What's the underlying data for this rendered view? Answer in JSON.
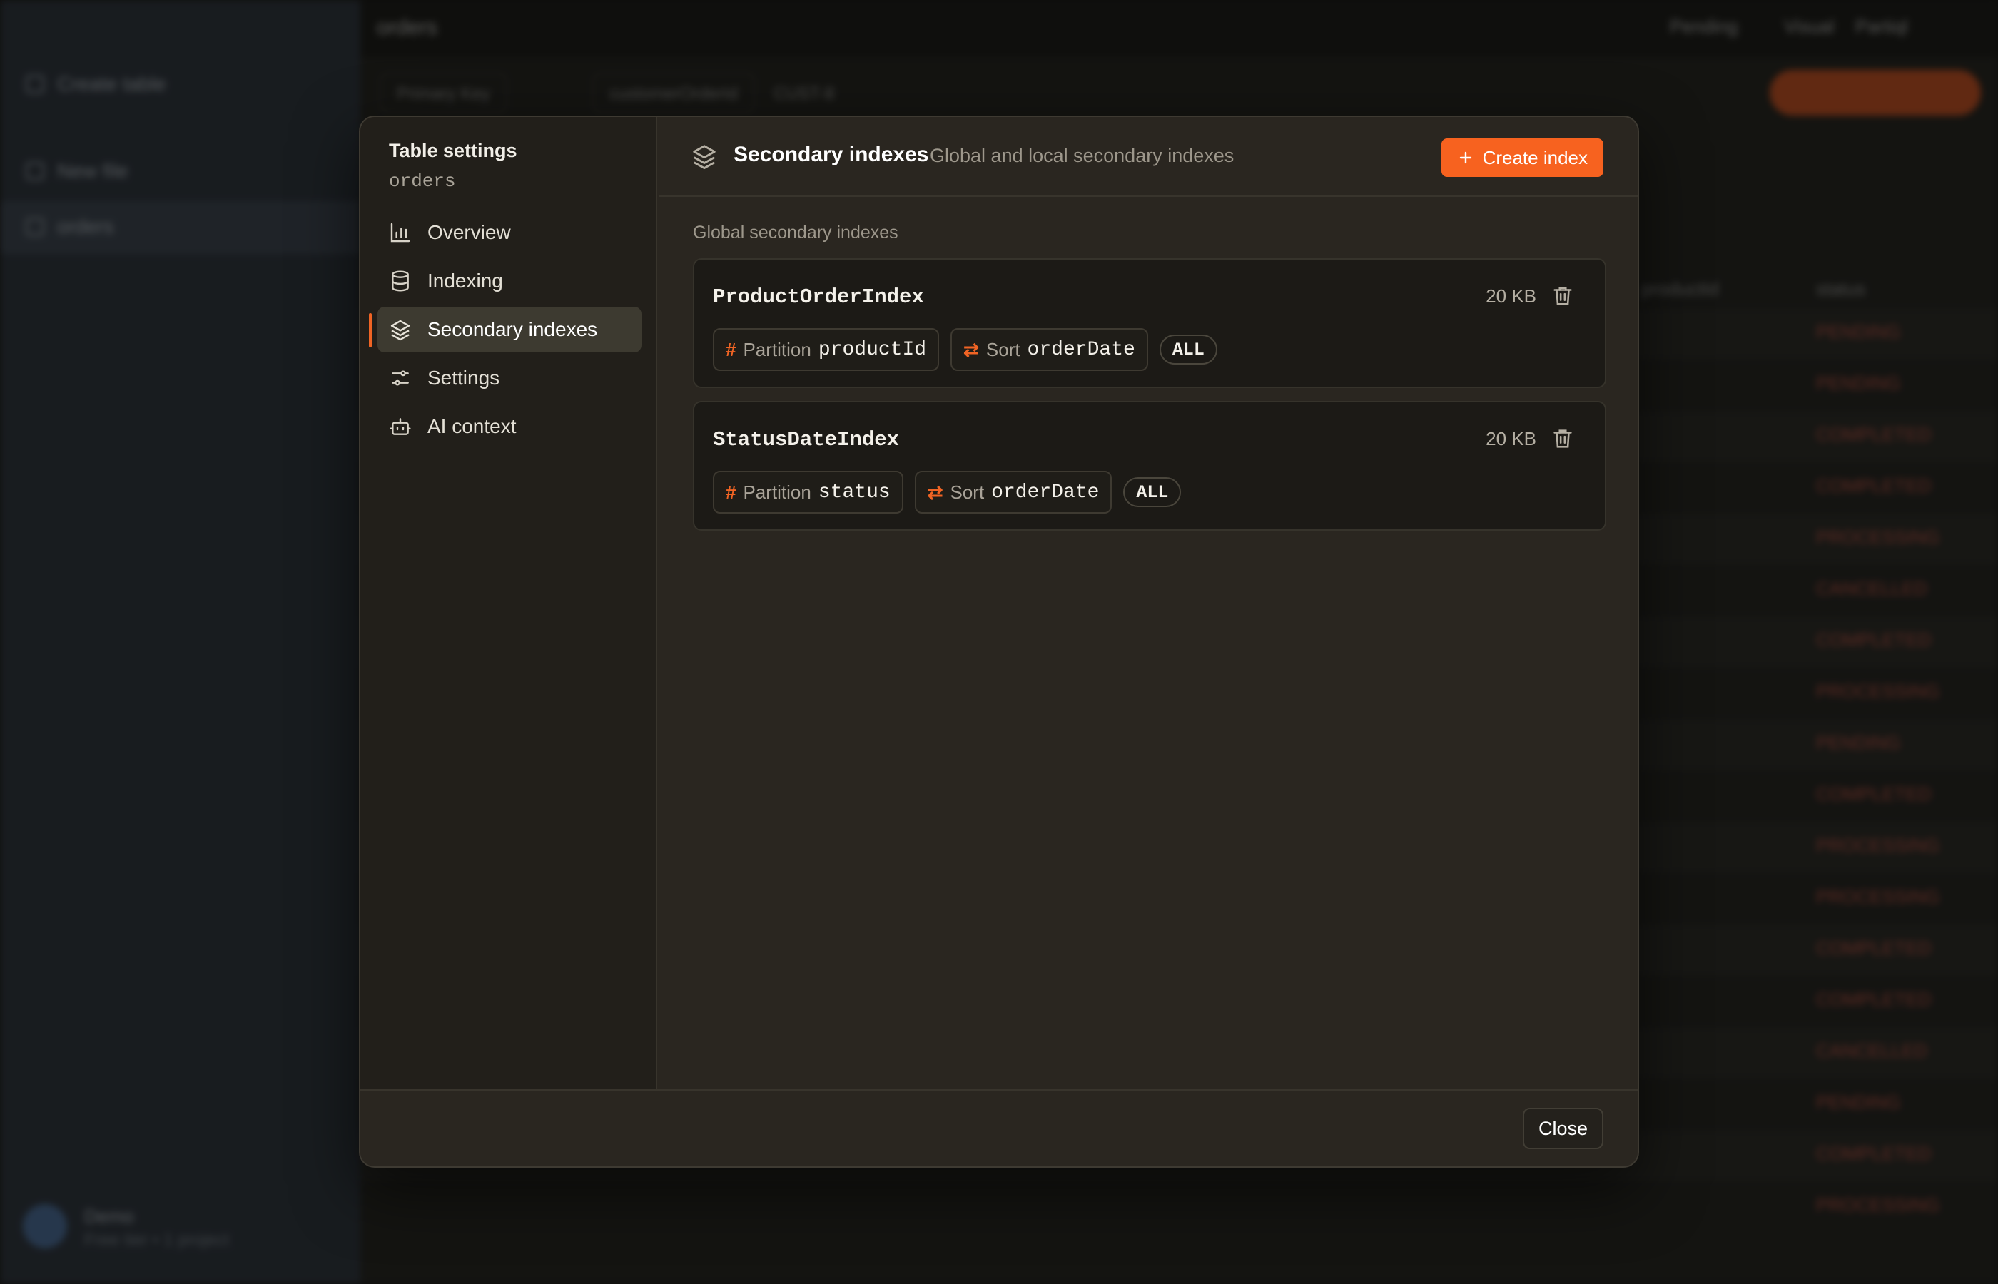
{
  "background": {
    "sidebar_items": [
      "Create table",
      "New file",
      "orders"
    ],
    "user_name": "Demo",
    "user_sub": "Free tier • 1 project",
    "table_title": "orders",
    "top_right": [
      "Pending",
      "Visual",
      "Partiql"
    ],
    "toolbar": [
      "Primary Key",
      "customerOrderId",
      "CUST-8"
    ],
    "columns": [
      "productId",
      "status"
    ],
    "statuses": [
      "PENDING",
      "PENDING",
      "COMPLETED",
      "COMPLETED",
      "PROCESSING",
      "CANCELLED",
      "COMPLETED",
      "PROCESSING",
      "PENDING",
      "COMPLETED",
      "PROCESSING",
      "PROCESSING",
      "COMPLETED",
      "COMPLETED",
      "CANCELLED",
      "PENDING",
      "COMPLETED",
      "PROCESSING"
    ]
  },
  "modal": {
    "title": "Table settings",
    "table_name": "orders",
    "nav": [
      {
        "label": "Overview",
        "icon": "bar-chart-icon"
      },
      {
        "label": "Indexing",
        "icon": "database-icon"
      },
      {
        "label": "Secondary indexes",
        "icon": "layers-icon"
      },
      {
        "label": "Settings",
        "icon": "sliders-icon"
      },
      {
        "label": "AI context",
        "icon": "bot-icon"
      }
    ],
    "header": {
      "title": "Secondary indexes",
      "description": "Global and local secondary indexes",
      "create_label": "Create index"
    },
    "section_label": "Global secondary indexes",
    "indexes": [
      {
        "name": "ProductOrderIndex",
        "size": "20 KB",
        "partition_label": "Partition",
        "partition_key": "productId",
        "sort_label": "Sort",
        "sort_key": "orderDate",
        "projection": "ALL"
      },
      {
        "name": "StatusDateIndex",
        "size": "20 KB",
        "partition_label": "Partition",
        "partition_key": "status",
        "sort_label": "Sort",
        "sort_key": "orderDate",
        "projection": "ALL"
      }
    ],
    "close_label": "Close"
  },
  "colors": {
    "accent": "#f7621f",
    "modal_bg": "#2a2620",
    "card_bg": "#1c1a16"
  }
}
